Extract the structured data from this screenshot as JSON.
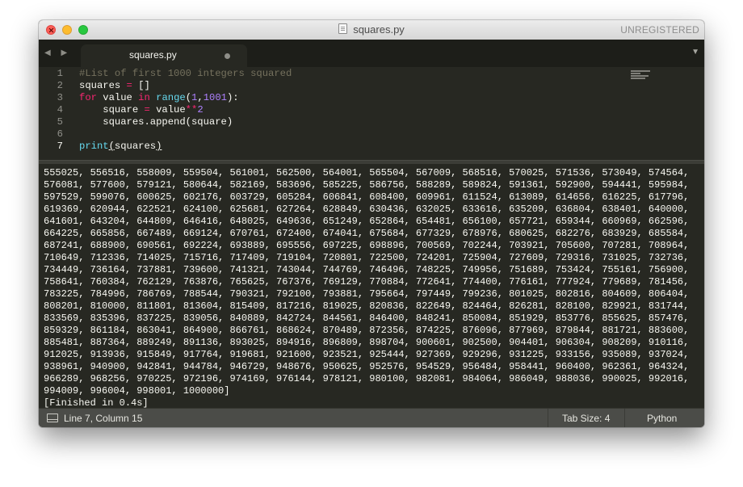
{
  "window": {
    "title": "squares.py",
    "registration": "UNREGISTERED"
  },
  "tabs": [
    {
      "label": "squares.py",
      "dirty": true
    }
  ],
  "tabbar": {
    "nav_arrows": "◀ ▶",
    "dropdown_icon": "▼"
  },
  "editor": {
    "line_numbers": [
      "1",
      "2",
      "3",
      "4",
      "5",
      "6",
      "7"
    ],
    "active_line": 7,
    "lines": [
      "#List of first 1000 integers squared",
      "squares = []",
      "for value in range(1,1001):",
      "    square = value**2",
      "    squares.append(square)",
      "",
      "print(squares)"
    ]
  },
  "output": {
    "lines": [
      "555025, 556516, 558009, 559504, 561001, 562500, 564001, 565504, 567009, 568516, 570025, 571536, 573049, 574564,",
      "576081, 577600, 579121, 580644, 582169, 583696, 585225, 586756, 588289, 589824, 591361, 592900, 594441, 595984,",
      "597529, 599076, 600625, 602176, 603729, 605284, 606841, 608400, 609961, 611524, 613089, 614656, 616225, 617796,",
      "619369, 620944, 622521, 624100, 625681, 627264, 628849, 630436, 632025, 633616, 635209, 636804, 638401, 640000,",
      "641601, 643204, 644809, 646416, 648025, 649636, 651249, 652864, 654481, 656100, 657721, 659344, 660969, 662596,",
      "664225, 665856, 667489, 669124, 670761, 672400, 674041, 675684, 677329, 678976, 680625, 682276, 683929, 685584,",
      "687241, 688900, 690561, 692224, 693889, 695556, 697225, 698896, 700569, 702244, 703921, 705600, 707281, 708964,",
      "710649, 712336, 714025, 715716, 717409, 719104, 720801, 722500, 724201, 725904, 727609, 729316, 731025, 732736,",
      "734449, 736164, 737881, 739600, 741321, 743044, 744769, 746496, 748225, 749956, 751689, 753424, 755161, 756900,",
      "758641, 760384, 762129, 763876, 765625, 767376, 769129, 770884, 772641, 774400, 776161, 777924, 779689, 781456,",
      "783225, 784996, 786769, 788544, 790321, 792100, 793881, 795664, 797449, 799236, 801025, 802816, 804609, 806404,",
      "808201, 810000, 811801, 813604, 815409, 817216, 819025, 820836, 822649, 824464, 826281, 828100, 829921, 831744,",
      "833569, 835396, 837225, 839056, 840889, 842724, 844561, 846400, 848241, 850084, 851929, 853776, 855625, 857476,",
      "859329, 861184, 863041, 864900, 866761, 868624, 870489, 872356, 874225, 876096, 877969, 879844, 881721, 883600,",
      "885481, 887364, 889249, 891136, 893025, 894916, 896809, 898704, 900601, 902500, 904401, 906304, 908209, 910116,",
      "912025, 913936, 915849, 917764, 919681, 921600, 923521, 925444, 927369, 929296, 931225, 933156, 935089, 937024,",
      "938961, 940900, 942841, 944784, 946729, 948676, 950625, 952576, 954529, 956484, 958441, 960400, 962361, 964324,",
      "966289, 968256, 970225, 972196, 974169, 976144, 978121, 980100, 982081, 984064, 986049, 988036, 990025, 992016,",
      "994009, 996004, 998001, 1000000]",
      "[Finished in 0.4s]"
    ]
  },
  "status": {
    "position": "Line 7, Column 15",
    "tab_size": "Tab Size: 4",
    "syntax": "Python"
  },
  "colors": {
    "background": "#272822",
    "comment": "#75715e",
    "keyword": "#f92672",
    "function": "#66d9ef",
    "number": "#ae81ff",
    "text": "#f8f8f2"
  }
}
